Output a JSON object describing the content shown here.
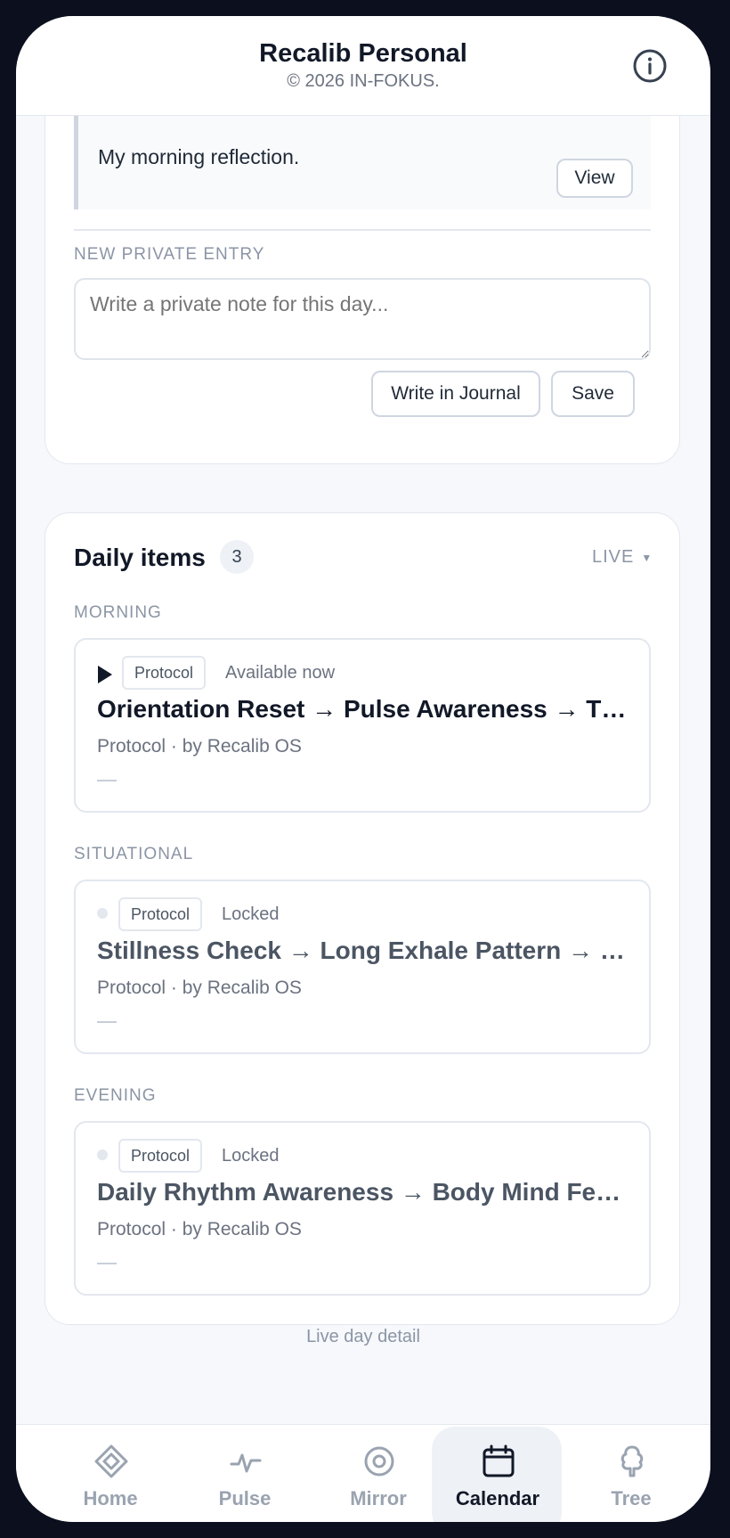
{
  "header": {
    "title": "Recalib Personal",
    "subtitle": "© 2026 IN-FOKUS.",
    "info_icon": "info-icon"
  },
  "journal": {
    "reflection_text": "My morning reflection.",
    "view_label": "View",
    "new_entry_label": "NEW PRIVATE ENTRY",
    "entry_placeholder": "Write a private note for this day...",
    "write_journal_label": "Write in Journal",
    "save_label": "Save"
  },
  "daily": {
    "title": "Daily items",
    "count": "3",
    "mode": "LIVE",
    "sections": [
      {
        "label": "MORNING",
        "item": {
          "tag": "Protocol",
          "status": "Available now",
          "title": "Orientation Reset → Pulse Awareness → Th...",
          "meta": "Protocol · by Recalib OS",
          "dash": "—"
        }
      },
      {
        "label": "SITUATIONAL",
        "item": {
          "tag": "Protocol",
          "status": "Locked",
          "title": "Stillness Check → Long Exhale Pattern → G...",
          "meta": "Protocol · by Recalib OS",
          "dash": "—"
        }
      },
      {
        "label": "EVENING",
        "item": {
          "tag": "Protocol",
          "status": "Locked",
          "title": "Daily Rhythm Awareness → Body Mind Feel...",
          "meta": "Protocol · by Recalib OS",
          "dash": "—"
        }
      }
    ]
  },
  "footer_note": "Live day detail",
  "nav": {
    "items": [
      {
        "label": "Home",
        "icon": "diamond-icon"
      },
      {
        "label": "Pulse",
        "icon": "pulse-icon"
      },
      {
        "label": "Mirror",
        "icon": "eye-icon"
      },
      {
        "label": "Calendar",
        "icon": "calendar-icon"
      },
      {
        "label": "Tree",
        "icon": "tree-icon"
      }
    ],
    "active": "Calendar"
  },
  "colors": {
    "background": "#f6f8fb",
    "frame": "#0b0f1e",
    "text": "#111827",
    "muted": "#8b95a5"
  }
}
